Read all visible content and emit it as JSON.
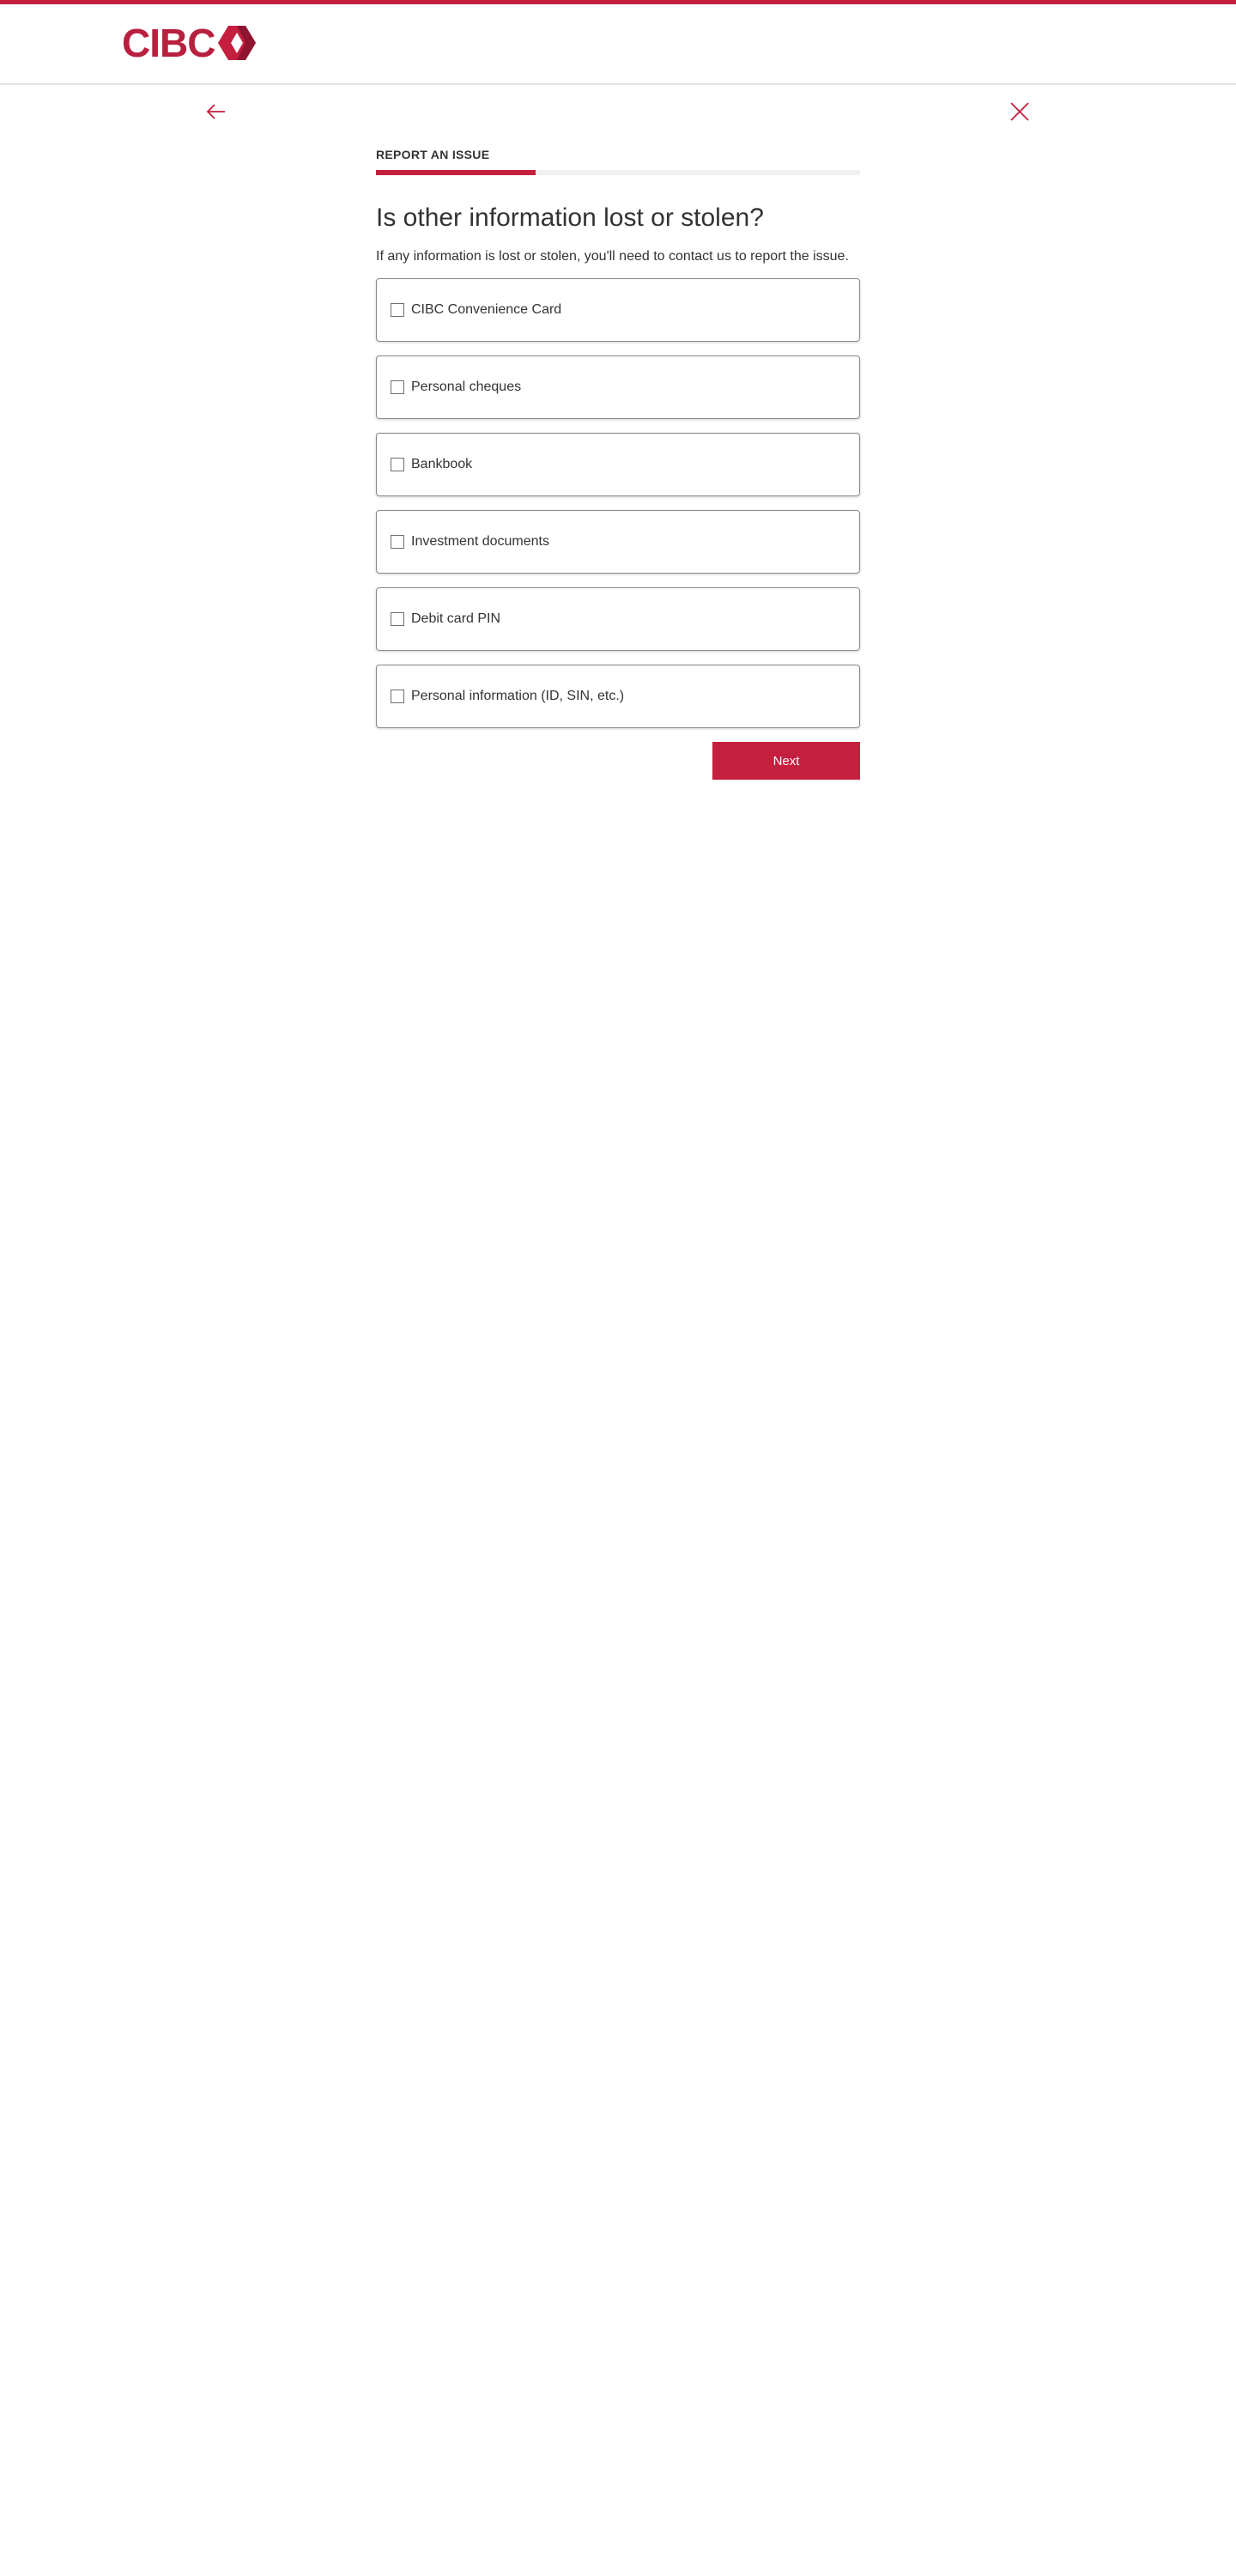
{
  "brand": {
    "name": "CIBC",
    "accent_color": "#c41f3e"
  },
  "nav": {
    "back_icon": "arrow-left-icon",
    "close_icon": "close-icon"
  },
  "step": {
    "label": "REPORT AN ISSUE",
    "progress": 0.33
  },
  "question": {
    "title": "Is other information lost or stolen?",
    "intro": "If any information is lost or stolen, you'll need to contact us to report the issue."
  },
  "options": [
    {
      "label": "CIBC Convenience Card",
      "checked": false
    },
    {
      "label": "Personal cheques",
      "checked": false
    },
    {
      "label": "Bankbook",
      "checked": false
    },
    {
      "label": "Investment documents",
      "checked": false
    },
    {
      "label": "Debit card PIN",
      "checked": false
    },
    {
      "label": "Personal information (ID, SIN, etc.)",
      "checked": false
    }
  ],
  "actions": {
    "next_label": "Next"
  }
}
